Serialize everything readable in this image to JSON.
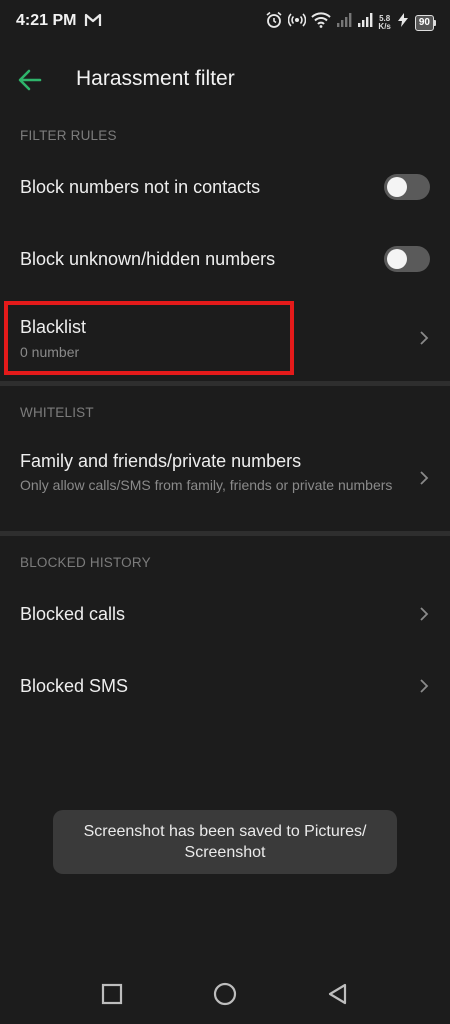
{
  "status_bar": {
    "time": "4:21 PM",
    "net_speed_value": "5.8",
    "net_speed_unit": "K/s",
    "battery": "90",
    "icons": [
      "gmail-icon",
      "alarm-icon",
      "hotspot-icon",
      "wifi-icon",
      "signal-icon",
      "signal-icon",
      "charging-icon",
      "battery-icon"
    ]
  },
  "header": {
    "title": "Harassment filter"
  },
  "filter_rules": {
    "label": "FILTER RULES",
    "items": [
      {
        "title": "Block numbers not in contacts",
        "enabled": false
      },
      {
        "title": "Block unknown/hidden numbers",
        "enabled": false
      }
    ],
    "blacklist": {
      "title": "Blacklist",
      "subtitle": "0 number"
    }
  },
  "whitelist": {
    "label": "WHITELIST",
    "item": {
      "title": "Family and friends/private numbers",
      "subtitle": "Only allow calls/SMS from family, friends or private numbers"
    }
  },
  "blocked_history": {
    "label": "BLOCKED HISTORY",
    "items": [
      {
        "title": "Blocked calls"
      },
      {
        "title": "Blocked SMS"
      }
    ]
  },
  "toast": {
    "text": "Screenshot has been saved to  Pictures/ Screenshot"
  },
  "colors": {
    "accent": "#2fb46b",
    "highlight": "#e41a1a",
    "background": "#1c1c1c"
  }
}
